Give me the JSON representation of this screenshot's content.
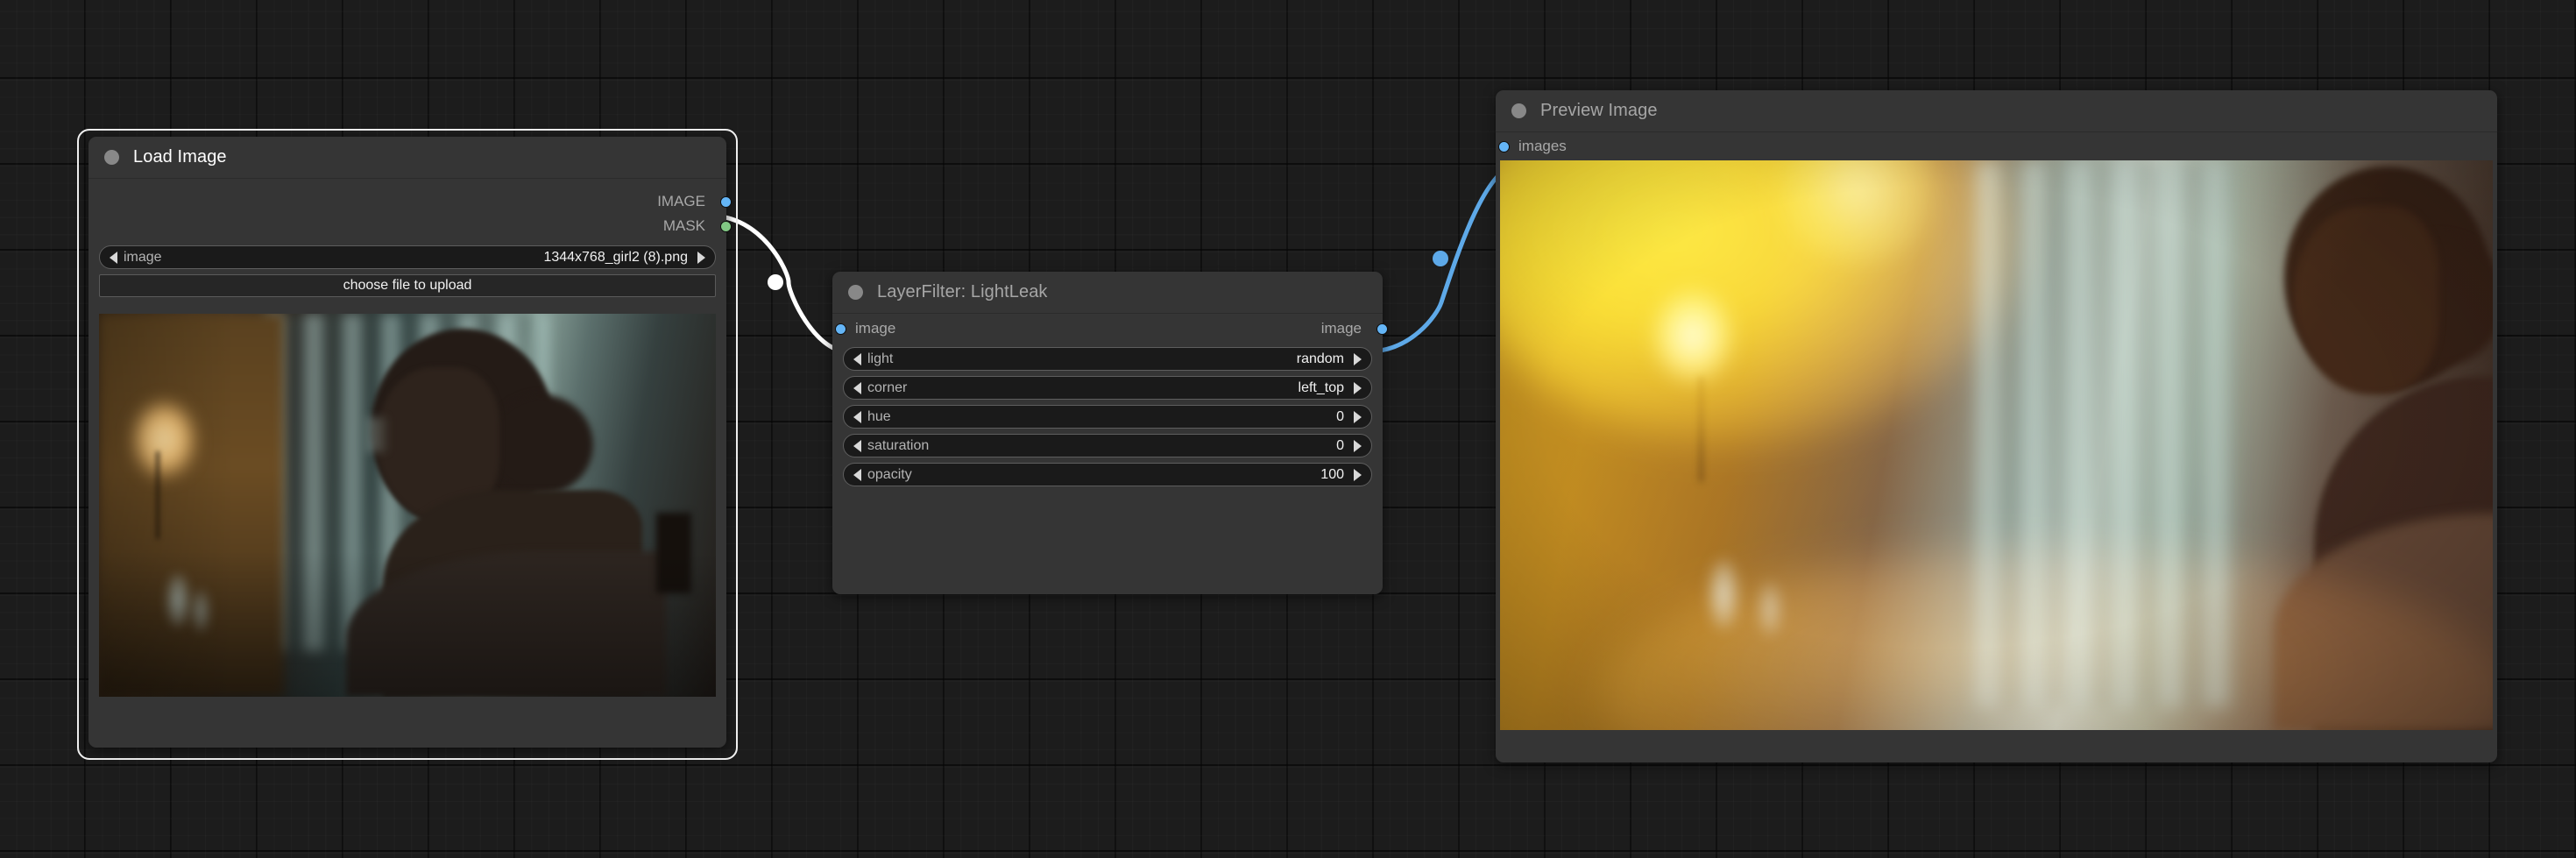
{
  "canvas": {
    "background_color": "#1c1c1c",
    "grid_minor_color": "#232323",
    "grid_major_color": "#101010"
  },
  "palette": {
    "node_background": "#353535",
    "node_header": "#353535",
    "widget_background": "#1a1a1a",
    "slot_image_color": "#64b5f6",
    "slot_mask_color": "#81c784",
    "link_white": "#ffffff",
    "link_blue": "#5ea9e8",
    "selection_outline": "#f2f2f2"
  },
  "nodes": [
    {
      "id": "load-image",
      "title": "Load Image",
      "selected": true,
      "outputs": [
        {
          "label": "IMAGE",
          "color": "#64b5f6"
        },
        {
          "label": "MASK",
          "color": "#81c784"
        }
      ],
      "widgets": [
        {
          "type": "combo",
          "label": "image",
          "value": "1344x768_girl2 (8).png"
        },
        {
          "type": "button",
          "label": "choose file to upload"
        }
      ],
      "image_preview": {
        "description": "dark interior, woman silhouette profile with hair bun, warm lamp on left, teal window light"
      }
    },
    {
      "id": "layerfilter-lightleak",
      "title": "LayerFilter: LightLeak",
      "selected": false,
      "inputs": [
        {
          "label": "image",
          "color": "#64b5f6"
        }
      ],
      "outputs": [
        {
          "label": "image",
          "color": "#64b5f6"
        }
      ],
      "widgets": [
        {
          "type": "combo",
          "label": "light",
          "value": "random"
        },
        {
          "type": "combo",
          "label": "corner",
          "value": "left_top"
        },
        {
          "type": "number",
          "label": "hue",
          "value": "0"
        },
        {
          "type": "number",
          "label": "saturation",
          "value": "0"
        },
        {
          "type": "number",
          "label": "opacity",
          "value": "100"
        }
      ]
    },
    {
      "id": "preview-image",
      "title": "Preview Image",
      "selected": false,
      "inputs": [
        {
          "label": "images",
          "color": "#64b5f6"
        }
      ],
      "image_preview": {
        "description": "same portrait with warm yellow/orange light leak applied from top-left corner"
      }
    }
  ],
  "links": [
    {
      "from": "load-image.IMAGE",
      "to": "layerfilter-lightleak.image",
      "color": "#ffffff"
    },
    {
      "from": "layerfilter-lightleak.image",
      "to": "preview-image.images",
      "color": "#5ea9e8"
    }
  ]
}
